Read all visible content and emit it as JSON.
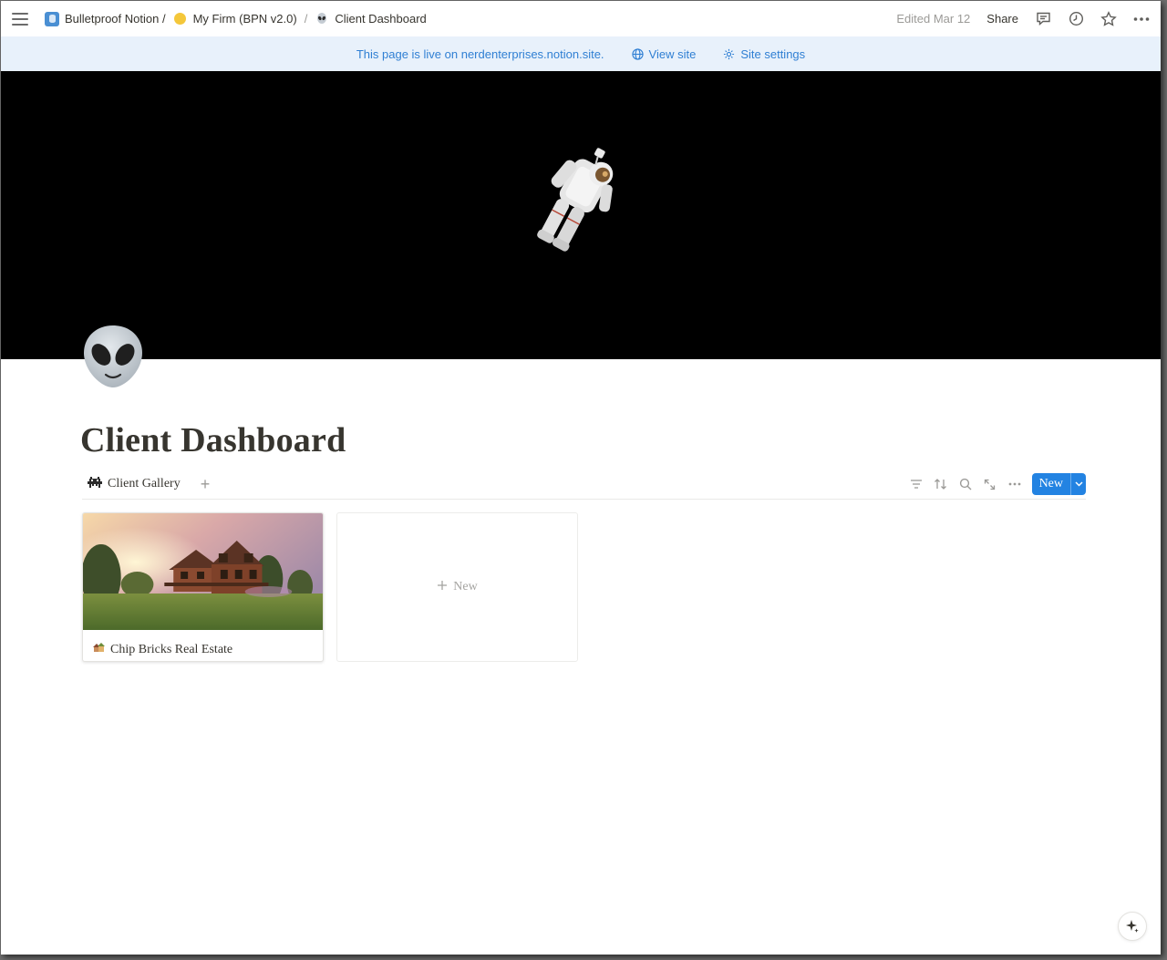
{
  "topbar": {
    "breadcrumbs": [
      {
        "label": "Bulletproof Notion /"
      },
      {
        "label": "My Firm (BPN v2.0)"
      },
      {
        "label": "Client Dashboard"
      }
    ],
    "separator": "/",
    "edited": "Edited Mar 12",
    "share": "Share"
  },
  "banner": {
    "text": "This page is live on nerdenterprises.notion.site.",
    "view_site": "View site",
    "site_settings": "Site settings"
  },
  "page": {
    "title": "Client Dashboard"
  },
  "database": {
    "view_name": "Client Gallery",
    "add_view": "+",
    "new_label": "New"
  },
  "gallery": {
    "cards": [
      {
        "title": "Chip Bricks Real Estate"
      }
    ],
    "new_card_label": "New"
  },
  "colors": {
    "accent": "#2383e2",
    "banner_bg": "#e8f1fb",
    "banner_text": "#2f7fd3"
  }
}
